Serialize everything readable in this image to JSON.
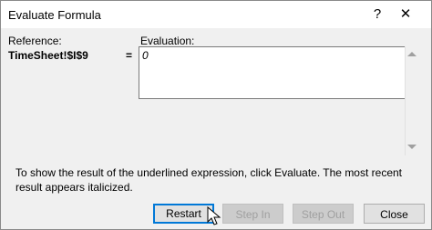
{
  "window": {
    "title": "Evaluate Formula",
    "help_glyph": "?",
    "close_glyph": "✕"
  },
  "reference": {
    "label": "Reference:",
    "value": "TimeSheet!$I$9",
    "equals": "="
  },
  "evaluation": {
    "label": "Evaluation:",
    "value": "0"
  },
  "message": "To show the result of the underlined expression, click Evaluate.  The most recent result appears italicized.",
  "buttons": {
    "restart": "Restart",
    "step_in": "Step In",
    "step_out": "Step Out",
    "close": "Close"
  },
  "colors": {
    "accent": "#0078d7",
    "disabled_text": "#a0a0a0"
  }
}
